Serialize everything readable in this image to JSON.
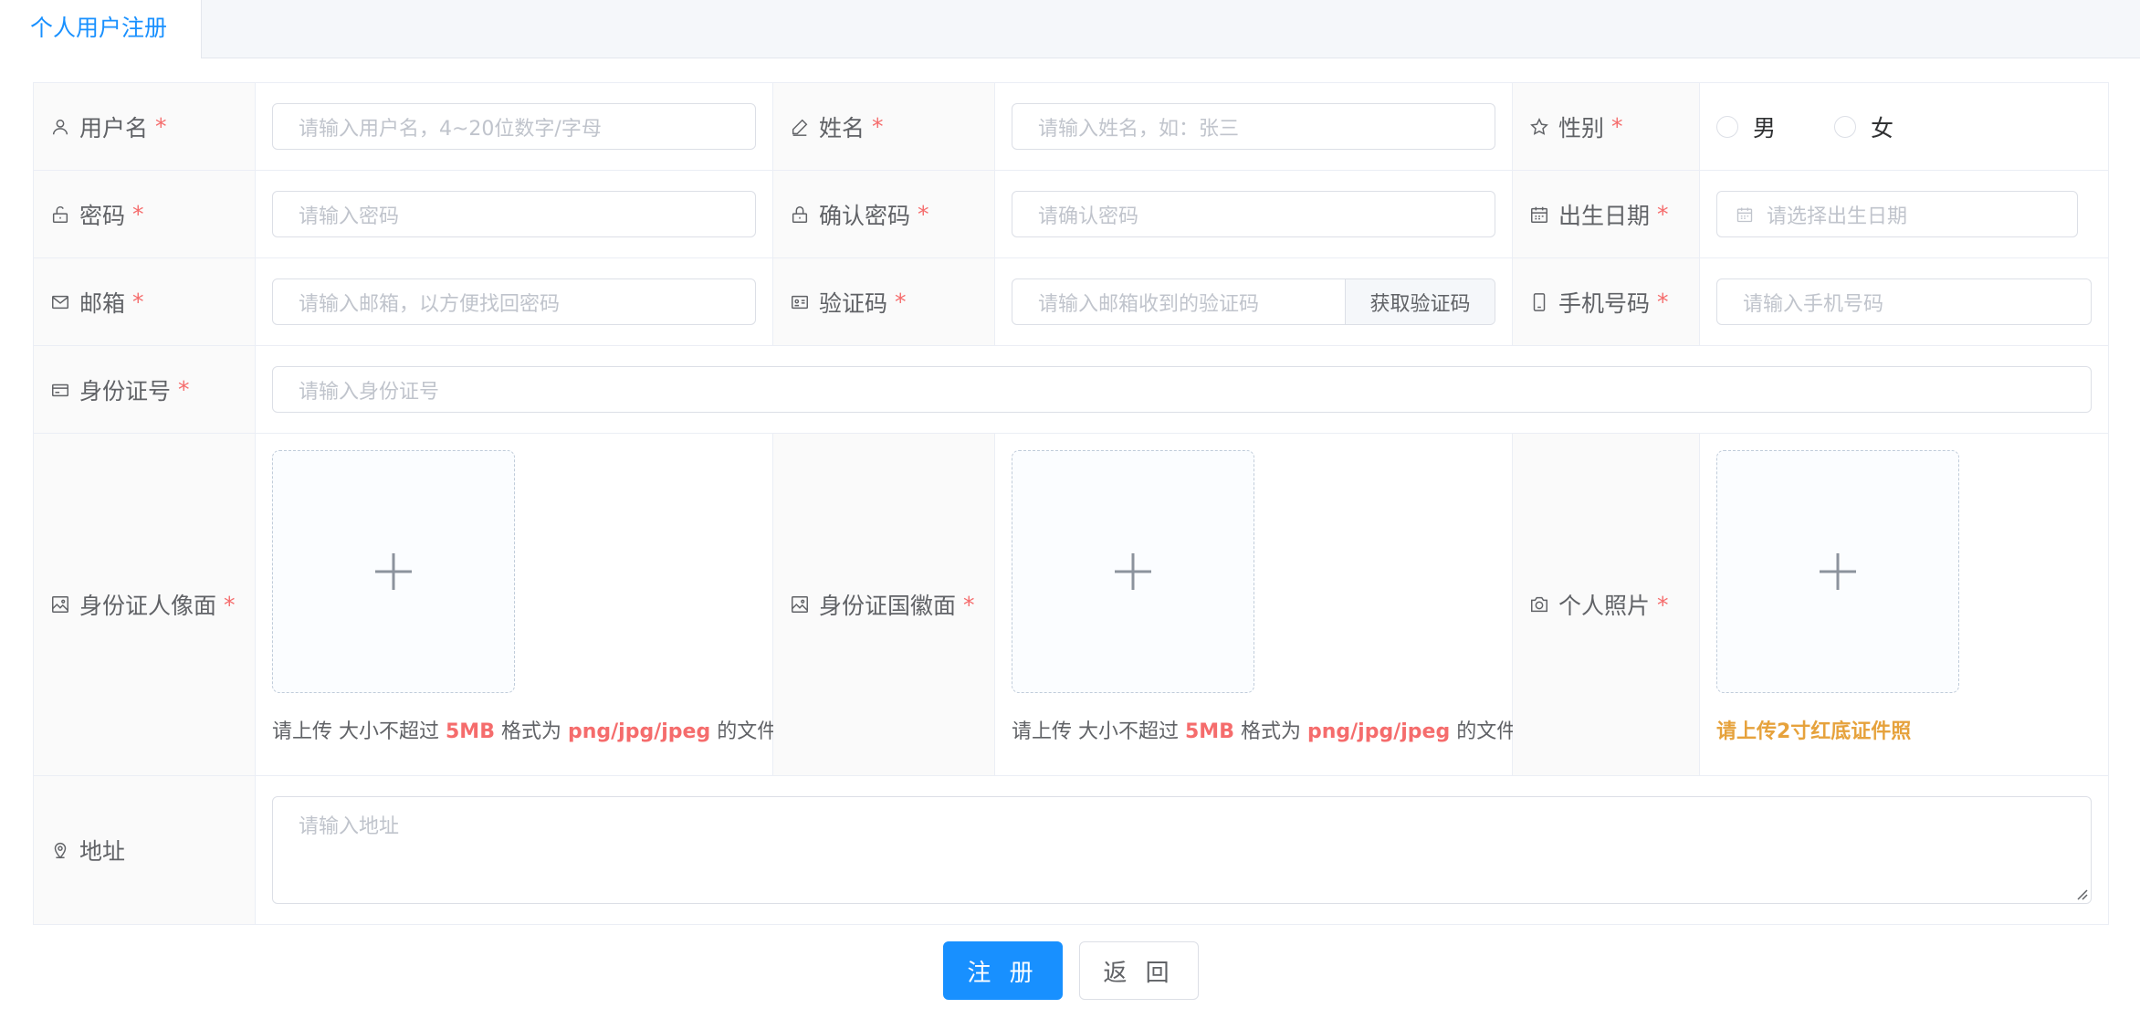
{
  "tab": {
    "label": "个人用户注册"
  },
  "required_mark": "*",
  "fields": {
    "username": {
      "label": "用户名",
      "placeholder": "请输入用户名，4~20位数字/字母"
    },
    "name": {
      "label": "姓名",
      "placeholder": "请输入姓名，如：张三"
    },
    "gender": {
      "label": "性别",
      "options": [
        "男",
        "女"
      ]
    },
    "password": {
      "label": "密码",
      "placeholder": "请输入密码"
    },
    "confirm_password": {
      "label": "确认密码",
      "placeholder": "请确认密码"
    },
    "birthdate": {
      "label": "出生日期",
      "placeholder": "请选择出生日期"
    },
    "email": {
      "label": "邮箱",
      "placeholder": "请输入邮箱，以方便找回密码"
    },
    "code": {
      "label": "验证码",
      "placeholder": "请输入邮箱收到的验证码",
      "button": "获取验证码"
    },
    "phone": {
      "label": "手机号码",
      "placeholder": "请输入手机号码"
    },
    "idnum": {
      "label": "身份证号",
      "placeholder": "请输入身份证号"
    },
    "id_front": {
      "label": "身份证人像面"
    },
    "id_back": {
      "label": "身份证国徽面"
    },
    "photo": {
      "label": "个人照片",
      "tip": "请上传2寸红底证件照"
    },
    "address": {
      "label": "地址",
      "placeholder": "请输入地址"
    }
  },
  "upload_tip": {
    "p1": "请上传 大小不超过 ",
    "size": "5MB",
    "p2": " 格式为 ",
    "formats": "png/jpg/jpeg",
    "p3": " 的文件"
  },
  "buttons": {
    "submit": "注 册",
    "back": "返 回"
  },
  "colors": {
    "primary": "#1890ff",
    "required": "#f56c6c",
    "warning": "#e6a23c"
  }
}
